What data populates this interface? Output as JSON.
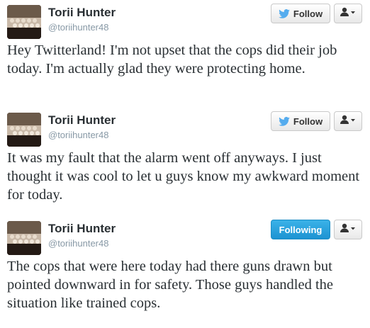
{
  "tweets": [
    {
      "name": "Torii Hunter",
      "handle": "@toriihunter48",
      "button_label": "Follow",
      "button_state": "follow",
      "text": "Hey Twitterland! I'm not upset that the cops did their job today. I'm actually glad they were protecting home."
    },
    {
      "name": "Torii Hunter",
      "handle": "@toriihunter48",
      "button_label": "Follow",
      "button_state": "follow",
      "text": "It was my fault that the alarm went off anyways. I just thought it was cool to let u guys know my awkward moment for today."
    },
    {
      "name": "Torii Hunter",
      "handle": "@toriihunter48",
      "button_label": "Following",
      "button_state": "following",
      "text": "The cops that were here today had there guns drawn but pointed downward in for safety. Those guys handled the situation like trained cops."
    }
  ],
  "icons": {
    "bird": "twitter-bird-icon",
    "user_menu": "user-dropdown-icon"
  },
  "colors": {
    "follow_bird": "#55acee",
    "following_bg": "#2aa0dd",
    "name": "#292f33",
    "handle": "#8899a6"
  }
}
